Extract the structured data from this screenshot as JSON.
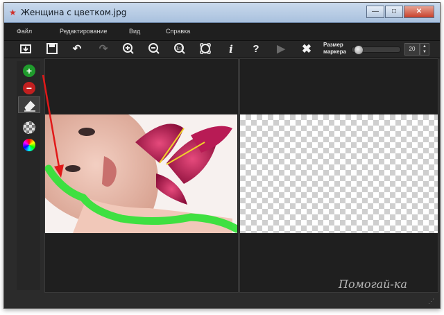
{
  "window": {
    "title": "Женщина с цветком.jpg"
  },
  "menu": {
    "file": "Файл",
    "edit": "Редактирование",
    "view": "Вид",
    "help": "Справка"
  },
  "toolbar": {
    "icons": [
      "import-icon",
      "save-icon",
      "undo-icon",
      "redo-icon",
      "zoom-in-icon",
      "zoom-out-icon",
      "actual-size-icon",
      "fit-icon",
      "info-icon",
      "help-icon",
      "play-icon",
      "close-x-icon"
    ],
    "marker_size_label": "Размер маркера",
    "marker_size_value": "20",
    "marker_size_fraction": 0.05
  },
  "tools": {
    "add_color": "#1f9b2c",
    "remove_color": "#c21f1f",
    "eraser_label": "eraser-icon",
    "background_label": "checkerboard-icon",
    "color_label": "color-wheel-icon"
  },
  "watermark": "Помогай-ка",
  "colors": {
    "green_stroke": "#35e23a",
    "arrow": "#e11919"
  }
}
